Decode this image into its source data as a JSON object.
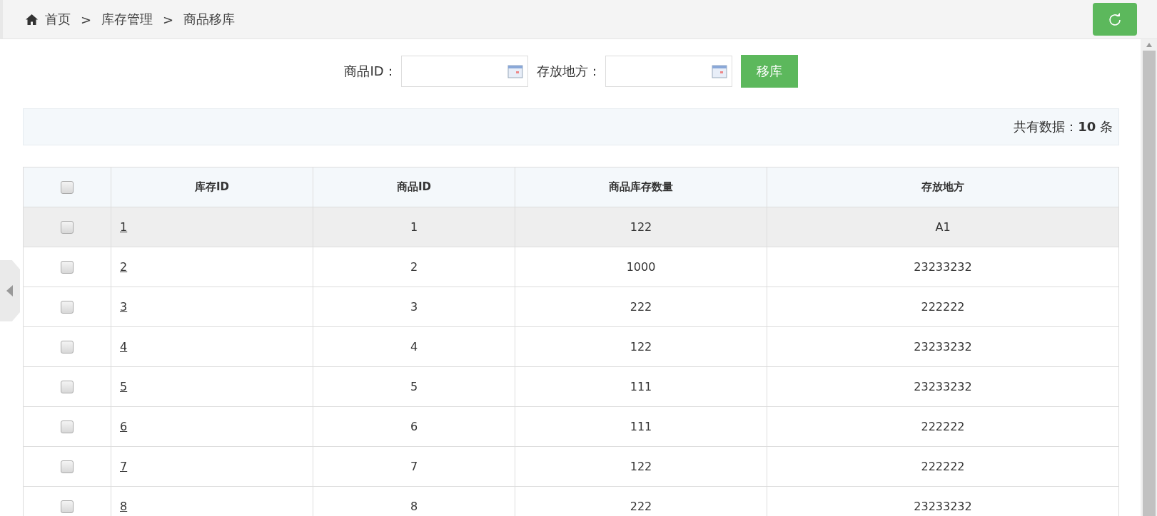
{
  "breadcrumb": {
    "items": [
      {
        "label": "首页"
      },
      {
        "label": "库存管理"
      },
      {
        "label": "商品移库"
      }
    ],
    "separator": ">"
  },
  "form": {
    "fields": [
      {
        "label": "商品ID："
      },
      {
        "label": "存放地方："
      }
    ],
    "submit": "移库"
  },
  "summary": {
    "prefix": "共有数据：",
    "count": "10",
    "suffix": "条"
  },
  "table": {
    "header_checked": false,
    "columns": [
      "库存ID",
      "商品ID",
      "商品库存数量",
      "存放地方"
    ],
    "rows": [
      {
        "checked": false,
        "highlighted": true,
        "cells": [
          "1",
          "1",
          "122",
          "A1"
        ]
      },
      {
        "checked": false,
        "highlighted": false,
        "cells": [
          "2",
          "2",
          "1000",
          "23233232"
        ]
      },
      {
        "checked": false,
        "highlighted": false,
        "cells": [
          "3",
          "3",
          "222",
          "222222"
        ]
      },
      {
        "checked": false,
        "highlighted": false,
        "cells": [
          "4",
          "4",
          "122",
          "23233232"
        ]
      },
      {
        "checked": false,
        "highlighted": false,
        "cells": [
          "5",
          "5",
          "111",
          "23233232"
        ]
      },
      {
        "checked": false,
        "highlighted": false,
        "cells": [
          "6",
          "6",
          "111",
          "222222"
        ]
      },
      {
        "checked": false,
        "highlighted": false,
        "cells": [
          "7",
          "7",
          "122",
          "222222"
        ]
      },
      {
        "checked": false,
        "highlighted": false,
        "cells": [
          "8",
          "8",
          "222",
          "23233232"
        ]
      }
    ]
  }
}
